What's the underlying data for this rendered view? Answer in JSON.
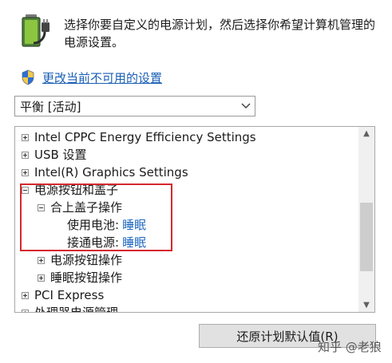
{
  "header": {
    "line1": "选择你要自定义的电源计划，然后选择你希望计算机管理的",
    "line2": "电源设置。",
    "icon": "power-battery-icon"
  },
  "change_link": {
    "label": "更改当前不可用的设置",
    "icon": "uac-shield-icon"
  },
  "plan_select": {
    "value": "平衡 [活动]",
    "icon": "chevron-down-icon"
  },
  "tree": {
    "items": [
      {
        "label": "Intel CPPC Energy Efficiency Settings",
        "state": "collapsed"
      },
      {
        "label": "USB 设置",
        "state": "collapsed"
      },
      {
        "label": "Intel(R) Graphics Settings",
        "state": "collapsed"
      },
      {
        "label": "电源按钮和盖子",
        "state": "expanded"
      },
      {
        "label": "合上盖子操作",
        "state": "expanded"
      },
      {
        "label": "使用电池:",
        "value": "睡眠"
      },
      {
        "label": "接通电源:",
        "value": "睡眠"
      },
      {
        "label": "电源按钮操作",
        "state": "collapsed"
      },
      {
        "label": "睡眠按钮操作",
        "state": "collapsed"
      },
      {
        "label": "PCI Express",
        "state": "collapsed"
      },
      {
        "label": "处理器电源管理",
        "state": "collapsed"
      }
    ]
  },
  "restore_button": {
    "label": "还原计划默认值(R)"
  },
  "watermark": "知乎 @老狼",
  "colors": {
    "link": "#1a5fb4",
    "value": "#1f68c1",
    "highlight": "#d6272e"
  }
}
